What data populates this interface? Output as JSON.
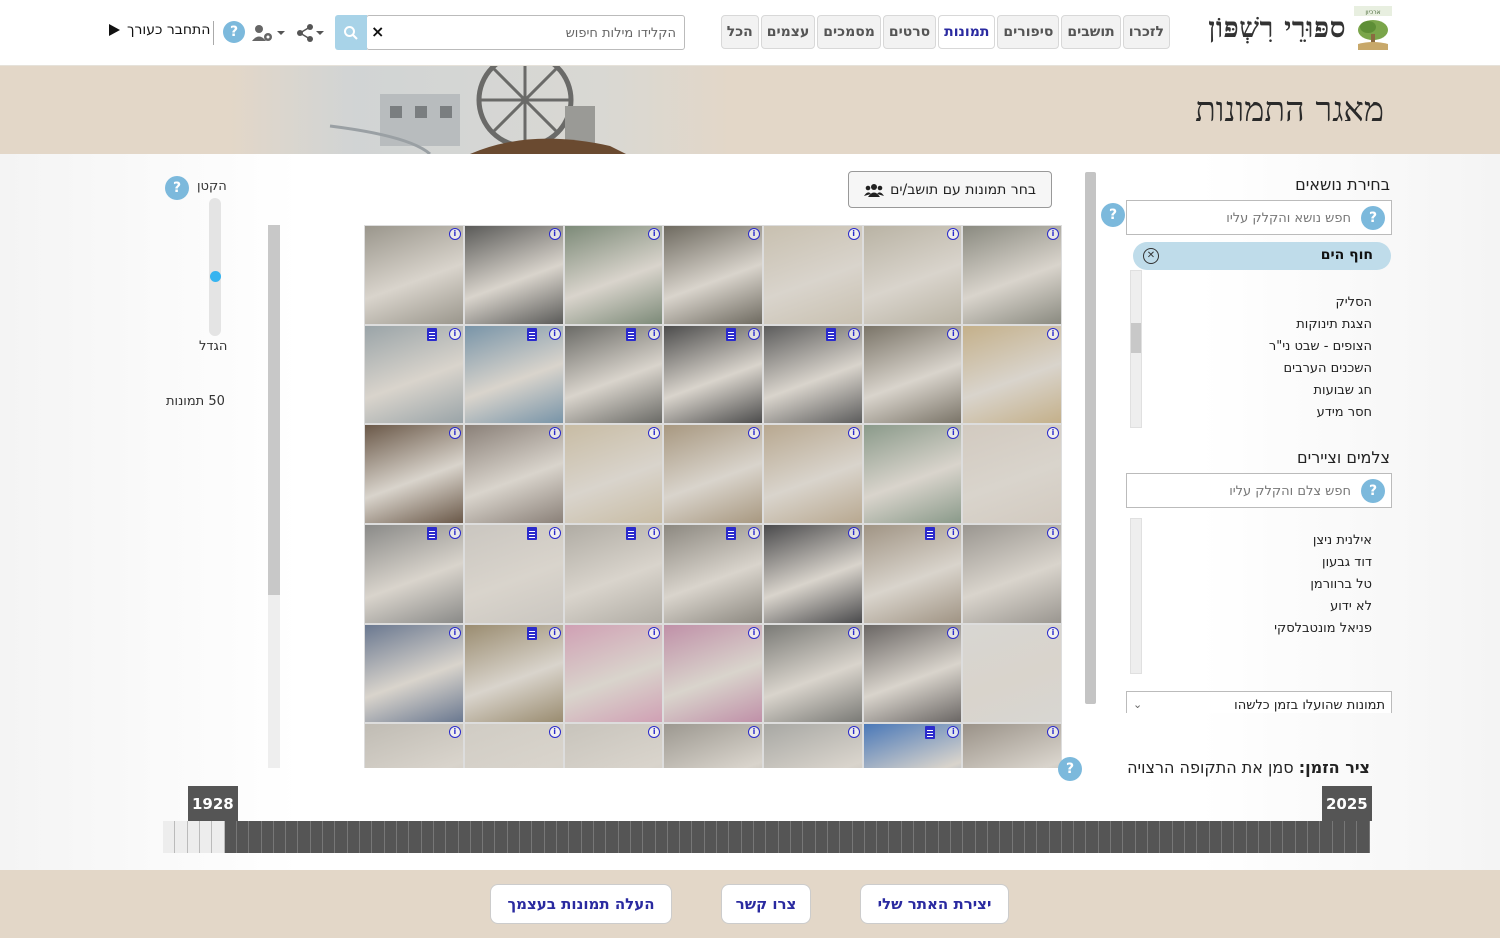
{
  "header": {
    "site_title": "ספּוּרֵי רִשְׁפּוֹן",
    "logo_caption": "ארכיון",
    "nav_tabs": [
      {
        "label": "לזכרו",
        "active": false
      },
      {
        "label": "תושבים",
        "active": false
      },
      {
        "label": "סיפורים",
        "active": false
      },
      {
        "label": "תמונות",
        "active": true
      },
      {
        "label": "סרטים",
        "active": false
      },
      {
        "label": "מסמכים",
        "active": false
      },
      {
        "label": "עצמים",
        "active": false
      },
      {
        "label": "הכל",
        "active": false
      }
    ],
    "search_placeholder": "הקלידו מילות חיפוש",
    "search_clear": "×",
    "help": "?",
    "login_label": "התחבר כעורך"
  },
  "banner": {
    "title": "מאגר התמונות"
  },
  "topics": {
    "title": "בחירת נושאים",
    "search_placeholder": "חפש נושא והקלק עליו",
    "selected": "חוף הים",
    "list": [
      "הסליק",
      "הצגת תינוקות",
      "הצופים - שבט ני\"ר",
      "השכנים הערבים",
      "חג שבועות",
      "חסר מידע"
    ]
  },
  "photographers": {
    "title": "צלמים וציירים",
    "search_placeholder": "חפש צלם והקלק עליו",
    "list": [
      "אילנית ניצן",
      "דוד גבעון",
      "טל ברוורמן",
      "לא ידוע",
      "פניאל מונטבלסקי"
    ]
  },
  "filter_dropdown": {
    "value": "תמונות שהועלו בזמן כלשהו"
  },
  "group_button": {
    "label": "בחר תמונות עם תושב/ים"
  },
  "zoom": {
    "smaller": "הקטן",
    "larger": "הגדל",
    "count_label": "50 תמונות",
    "level": 0.55
  },
  "timeline": {
    "label_bold": "ציר הזמן:",
    "label_rest": "סמן את התקופה הרצויה",
    "start_year": "1928",
    "end_year": "2025"
  },
  "footer": {
    "create_site": "יצירת האתר שלי",
    "contact": "צרו קשר",
    "upload": "העלה תמונות בעצמך"
  },
  "colors": {
    "accent": "#2a2aa0",
    "banner_bg": "#e3d7c8",
    "help_blue": "#7cb9dc",
    "chip_bg": "#bfdcea"
  },
  "photos": [
    {
      "tone": "#8a8a80",
      "doc": false
    },
    {
      "tone": "#b9b3a4",
      "doc": false
    },
    {
      "tone": "#c8c0b0",
      "doc": false
    },
    {
      "tone": "#6e6a60",
      "doc": false
    },
    {
      "tone": "#7c8a78",
      "doc": false
    },
    {
      "tone": "#5a5a58",
      "doc": false
    },
    {
      "tone": "#9a968c",
      "doc": false
    },
    {
      "tone": "#c4b08a",
      "doc": false
    },
    {
      "tone": "#7a7468",
      "doc": false
    },
    {
      "tone": "#5c5c5c",
      "doc": true
    },
    {
      "tone": "#4c4c4c",
      "doc": true
    },
    {
      "tone": "#6a6a66",
      "doc": true
    },
    {
      "tone": "#7894a8",
      "doc": true
    },
    {
      "tone": "#9aa4a8",
      "doc": true
    },
    {
      "tone": "#d2cac0",
      "doc": false
    },
    {
      "tone": "#8a9a8a",
      "doc": false
    },
    {
      "tone": "#b8a890",
      "doc": false
    },
    {
      "tone": "#a89880",
      "doc": false
    },
    {
      "tone": "#c8bca4",
      "doc": false
    },
    {
      "tone": "#8a8078",
      "doc": false
    },
    {
      "tone": "#6a5848",
      "doc": false
    },
    {
      "tone": "#9a9690",
      "doc": false
    },
    {
      "tone": "#a09484",
      "doc": true
    },
    {
      "tone": "#4a4a4c",
      "doc": false
    },
    {
      "tone": "#8c8880",
      "doc": true
    },
    {
      "tone": "#b0aca4",
      "doc": true
    },
    {
      "tone": "#cac6c0",
      "doc": true
    },
    {
      "tone": "#8a8a88",
      "doc": true
    },
    {
      "tone": "#d8d6d2",
      "doc": false
    },
    {
      "tone": "#6a6664",
      "doc": false
    },
    {
      "tone": "#7a7a76",
      "doc": false
    },
    {
      "tone": "#c090a8",
      "doc": false
    },
    {
      "tone": "#d0a0b4",
      "doc": false
    },
    {
      "tone": "#9a8c70",
      "doc": true
    },
    {
      "tone": "#6a7890",
      "doc": false
    },
    {
      "tone": "#9a9288",
      "doc": false
    },
    {
      "tone": "#4a78b8",
      "doc": true
    },
    {
      "tone": "#a8a8a4",
      "doc": false
    },
    {
      "tone": "#9c9890",
      "doc": false
    },
    {
      "tone": "#c8c4bc",
      "doc": false
    },
    {
      "tone": "#d0ccc4",
      "doc": false
    },
    {
      "tone": "#c0bcb4",
      "doc": false
    }
  ]
}
